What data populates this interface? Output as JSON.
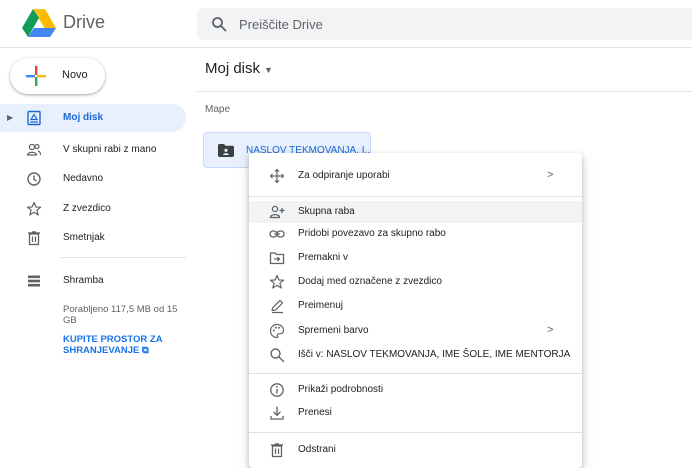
{
  "header": {
    "brand": "Drive",
    "search_placeholder": "Preiščite Drive"
  },
  "sidebar": {
    "new_label": "Novo",
    "items": [
      {
        "label": "Moj disk",
        "icon": "my-drive-icon",
        "active": true
      },
      {
        "label": "V skupni rabi z mano",
        "icon": "shared-users-icon",
        "active": false
      },
      {
        "label": "Nedavno",
        "icon": "clock-icon",
        "active": false
      },
      {
        "label": "Z zvezdico",
        "icon": "star-icon",
        "active": false
      },
      {
        "label": "Smetnjak",
        "icon": "trash-icon",
        "active": false
      },
      {
        "label": "Shramba",
        "icon": "storage-icon",
        "active": false
      }
    ],
    "storage_text": "Porabljeno 117,5 MB od 15 GB",
    "storage_link": "KUPITE PROSTOR ZA SHRANJEVANJE"
  },
  "main": {
    "breadcrumb": "Moj disk",
    "section_label": "Mape",
    "folder_name": "NASLOV TEKMOVANJA, I..."
  },
  "context_menu": {
    "items": [
      {
        "label": "Za odpiranje uporabi",
        "icon": "open-with-icon",
        "submenu": ">"
      },
      {
        "label": "Skupna raba",
        "icon": "share-person-icon"
      },
      {
        "label": "Pridobi povezavo za skupno rabo",
        "icon": "link-icon"
      },
      {
        "label": "Premakni v",
        "icon": "move-folder-icon"
      },
      {
        "label": "Dodaj med označene z zvezdico",
        "icon": "star-outline-icon"
      },
      {
        "label": "Preimenuj",
        "icon": "pencil-icon"
      },
      {
        "label": "Spremeni barvo",
        "icon": "palette-icon",
        "submenu": ">"
      },
      {
        "label": "Išči v: NASLOV TEKMOVANJA, IME ŠOLE, IME MENTORJA",
        "icon": "search-icon"
      },
      {
        "label": "Prikaži podrobnosti",
        "icon": "info-icon"
      },
      {
        "label": "Prenesi",
        "icon": "download-icon"
      },
      {
        "label": "Odstrani",
        "icon": "trash-icon"
      }
    ]
  },
  "colors": {
    "accent": "#1a73e8",
    "active_bg": "#e8f0fe",
    "hover_bg": "#f1f3f4"
  }
}
